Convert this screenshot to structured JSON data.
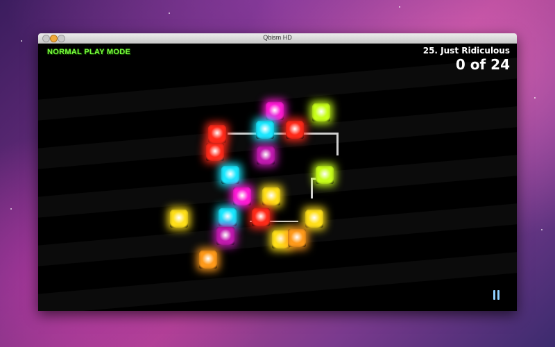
{
  "window": {
    "title": "Qbism HD"
  },
  "hud": {
    "mode": "NORMAL PLAY MODE",
    "level_name": "25. Just Ridiculous",
    "progress": "0 of 24"
  },
  "colors": {
    "red": "#ff2a1a",
    "magenta": "#ff1ad6",
    "yellow": "#ffe01a",
    "lime": "#c8ff1a",
    "cyan": "#1ae8ff",
    "orange": "#ff9a1a",
    "purple": "#c21ab0",
    "mode_label": "#7aff3d"
  },
  "board": {
    "cubes": [
      {
        "color": "magenta"
      },
      {
        "color": "lime"
      },
      {
        "color": "red"
      },
      {
        "color": "cyan"
      },
      {
        "color": "red"
      },
      {
        "color": "red"
      },
      {
        "color": "purple"
      },
      {
        "color": "cyan"
      },
      {
        "color": "lime"
      },
      {
        "color": "magenta"
      },
      {
        "color": "yellow"
      },
      {
        "color": "yellow"
      },
      {
        "color": "cyan"
      },
      {
        "color": "red"
      },
      {
        "color": "yellow"
      },
      {
        "color": "purple"
      },
      {
        "color": "yellow"
      },
      {
        "color": "orange"
      },
      {
        "color": "orange"
      }
    ]
  },
  "controls": {
    "pause_icon": "pause-icon"
  }
}
